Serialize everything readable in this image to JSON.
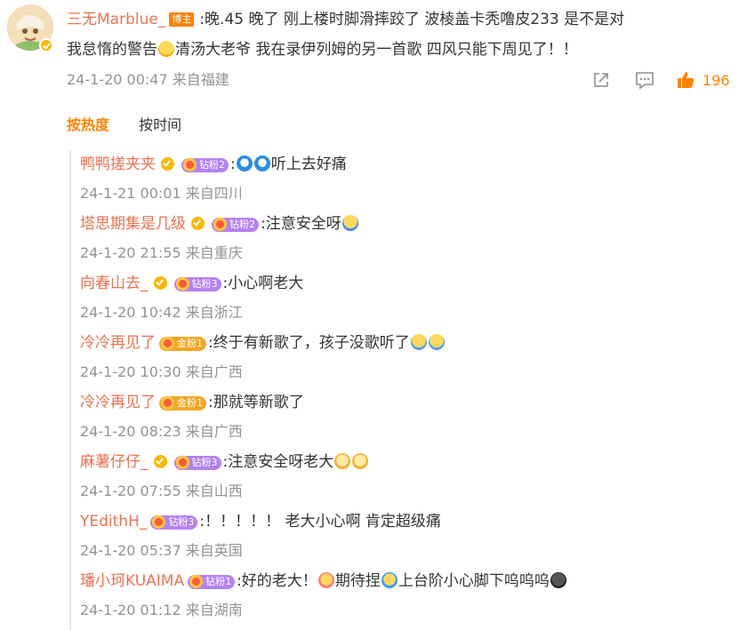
{
  "main_comment": {
    "username": "三无Marblue_",
    "badge": "博主",
    "text_line1": ":晚.45 晚了 刚上楼时脚滑摔跤了 波棱盖卡秃噜皮233 是不是对",
    "text_line2_a": "我怠惰的警告",
    "text_line2_b": "清汤大老爷 我在录伊列姆的另一首歌 四风只能下周见了！！",
    "meta": "24-1-20 00:47 来自福建",
    "like_count": "196"
  },
  "tabs": [
    {
      "label": "按热度",
      "active": true
    },
    {
      "label": "按时间",
      "active": false
    }
  ],
  "replies": [
    {
      "name": "鸭鸭搓夹夹",
      "verified": true,
      "fan": "钻粉2",
      "fan_color": "#b482f0",
      "text": ":",
      "text2": "听上去好痛",
      "meta": "24-1-21 00:01 来自四川"
    },
    {
      "name": "塔思期集是几级",
      "verified": true,
      "fan": "钻粉2",
      "fan_color": "#b482f0",
      "text": ":注意安全呀",
      "text2": "",
      "meta": "24-1-20 21:55 来自重庆"
    },
    {
      "name": "向春山去_",
      "verified": true,
      "fan": "钻粉3",
      "fan_color": "#b482f0",
      "text": ":小心啊老大",
      "text2": "",
      "meta": "24-1-20 10:42 来自浙江"
    },
    {
      "name": "冷冷再见了",
      "verified": false,
      "fan": "金粉1",
      "fan_color": "#f5a623",
      "text": ":终于有新歌了，孩子没歌听了",
      "text2": "",
      "meta": "24-1-20 10:30 来自广西"
    },
    {
      "name": "冷冷再见了",
      "verified": false,
      "fan": "金粉1",
      "fan_color": "#f5a623",
      "text": ":那就等新歌了",
      "text2": "",
      "meta": "24-1-20 08:23 来自广西"
    },
    {
      "name": "麻薯仔仔_",
      "verified": true,
      "fan": "钻粉3",
      "fan_color": "#b482f0",
      "text": ":注意安全呀老大",
      "text2": "",
      "meta": "24-1-20 07:55 来自山西"
    },
    {
      "name": "YEdithH_",
      "verified": false,
      "fan": "钻粉3",
      "fan_color": "#b482f0",
      "text": ":！！！！！ 老大小心啊 肯定超级痛",
      "text2": "",
      "meta": "24-1-20 05:37 来自英国"
    },
    {
      "name": "璠小珂KUAIMA",
      "verified": false,
      "fan": "钻粉1",
      "fan_color": "#b482f0",
      "text": ":好的老大！",
      "text2": "期待捏",
      "text3": "上台阶小心脚下呜呜呜",
      "meta": "24-1-20 01:12 来自湖南"
    }
  ],
  "icons": {
    "share": "share-icon",
    "comment": "comment-icon",
    "like": "thumbs-up-icon"
  },
  "colors": {
    "accent": "#ff8200",
    "username": "#eb7350",
    "meta": "#939393"
  }
}
